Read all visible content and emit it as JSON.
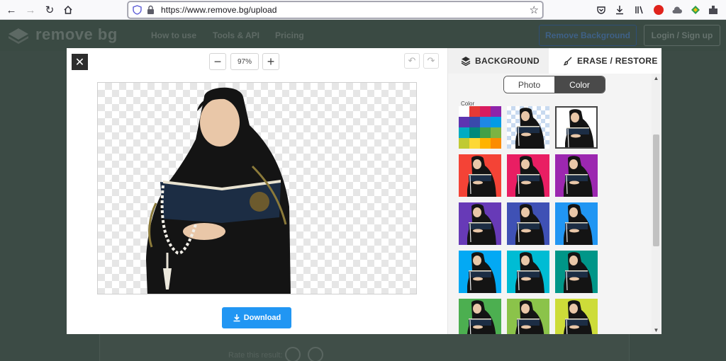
{
  "browser": {
    "url": "https://www.remove.bg/upload"
  },
  "site": {
    "logo_text": "remove bg",
    "nav": [
      "How to use",
      "Tools & API",
      "Pricing"
    ],
    "remove_background_label": "Remove Background",
    "login_label": "Login / Sign up",
    "rate_label": "Rate this result:"
  },
  "editor": {
    "zoom_value": "97%",
    "download_label": "Download",
    "tabs": {
      "background": "BACKGROUND",
      "erase_restore": "ERASE / RESTORE"
    },
    "toggle": {
      "photo": "Photo",
      "color": "Color"
    },
    "color_heading": "Color",
    "palette_colors": [
      "#ffffff",
      "#e53935",
      "#d81b60",
      "#8e24aa",
      "#5e35b1",
      "#3949ab",
      "#1e88e5",
      "#039be5",
      "#00acc1",
      "#00897b",
      "#43a047",
      "#7cb342",
      "#c0ca33",
      "#fdd835",
      "#ffb300",
      "#fb8c00"
    ],
    "swatches": [
      {
        "kind": "palette"
      },
      {
        "kind": "transparent"
      },
      {
        "kind": "color",
        "color": "#ffffff",
        "selected": true
      },
      {
        "kind": "color",
        "color": "#f44336"
      },
      {
        "kind": "color",
        "color": "#e91e63"
      },
      {
        "kind": "color",
        "color": "#9c27b0"
      },
      {
        "kind": "color",
        "color": "#673ab7"
      },
      {
        "kind": "color",
        "color": "#3f51b5"
      },
      {
        "kind": "color",
        "color": "#2196f3"
      },
      {
        "kind": "color",
        "color": "#03a9f4"
      },
      {
        "kind": "color",
        "color": "#00bcd4"
      },
      {
        "kind": "color",
        "color": "#009688"
      },
      {
        "kind": "color",
        "color": "#4caf50"
      },
      {
        "kind": "color",
        "color": "#8bc34a"
      },
      {
        "kind": "color",
        "color": "#cddc39"
      }
    ]
  },
  "colors": {
    "accent": "#2196f3",
    "dark": "#2d2d2d"
  }
}
